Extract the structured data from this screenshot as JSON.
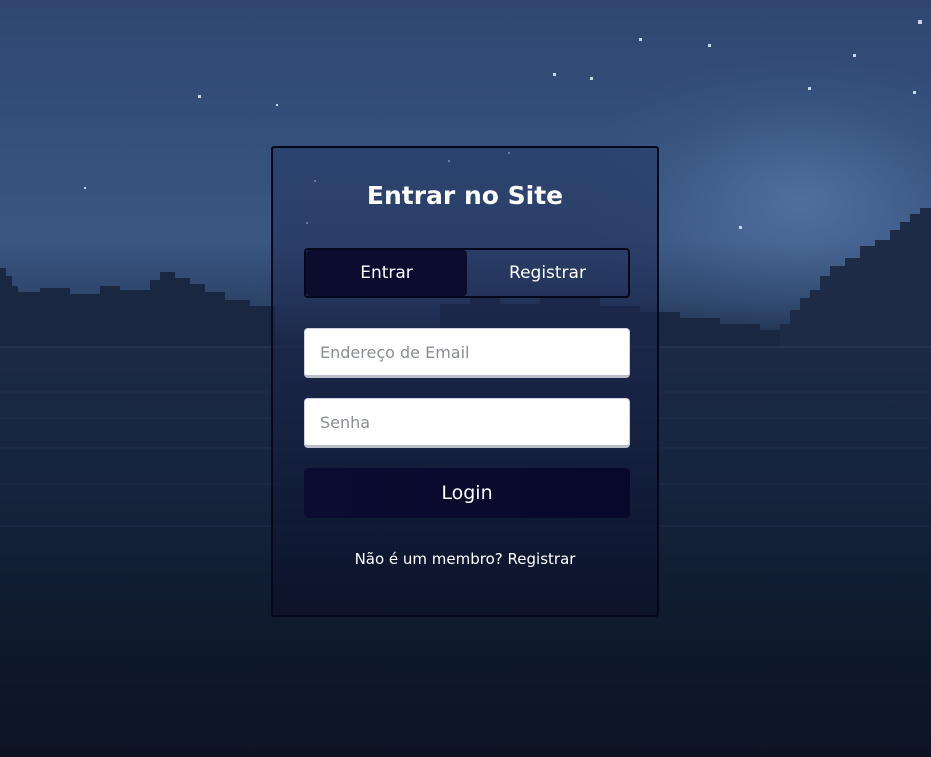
{
  "form": {
    "title": "Entrar no Site",
    "tabs": [
      {
        "label": "Entrar",
        "active": true
      },
      {
        "label": "Registrar",
        "active": false
      }
    ],
    "email": {
      "placeholder": "Endereço de Email",
      "value": ""
    },
    "password": {
      "placeholder": "Senha",
      "value": ""
    },
    "login_label": "Login",
    "footer_prefix": "Não é um membro?",
    "footer_link": "Registrar"
  },
  "colors": {
    "button_bg": "#0b0c2e",
    "card_border": "#05081a",
    "text": "#ffffff"
  }
}
